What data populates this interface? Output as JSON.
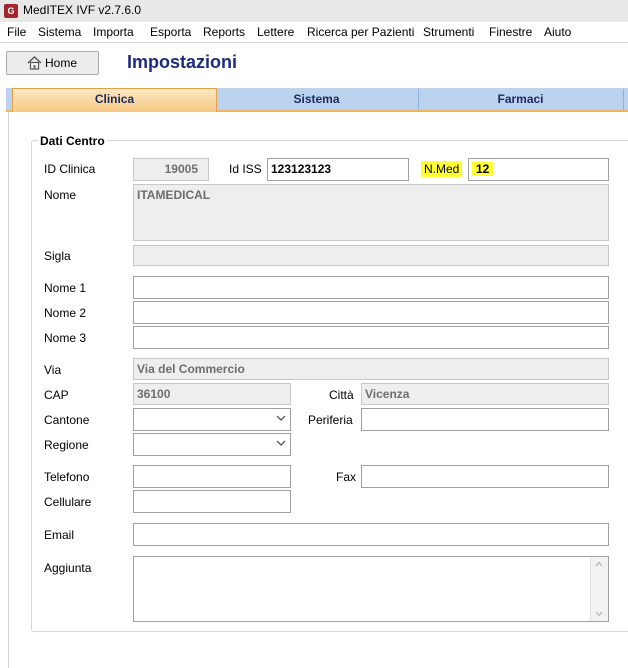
{
  "window": {
    "title": "MedITEX IVF v2.7.6.0",
    "logo_text": "G"
  },
  "menu": [
    "File",
    "Sistema",
    "Importa",
    "Esporta",
    "Reports",
    "Lettere",
    "Ricerca per Pazienti",
    "Strumenti",
    "Finestre",
    "Aiuto"
  ],
  "header": {
    "home_label": "Home",
    "page_title": "Impostazioni"
  },
  "tabs": [
    {
      "label": "Clinica",
      "active": true
    },
    {
      "label": "Sistema",
      "active": false
    },
    {
      "label": "Farmaci",
      "active": false
    }
  ],
  "group": {
    "legend": "Dati Centro",
    "labels": {
      "id_clinica": "ID Clinica",
      "id_iss": "Id ISS",
      "n_med": "N.Med",
      "nome": "Nome",
      "sigla": "Sigla",
      "nome1": "Nome 1",
      "nome2": "Nome 2",
      "nome3": "Nome 3",
      "via": "Via",
      "cap": "CAP",
      "citta": "Città",
      "cantone": "Cantone",
      "periferia": "Periferia",
      "regione": "Regione",
      "telefono": "Telefono",
      "fax": "Fax",
      "cellulare": "Cellulare",
      "email": "Email",
      "aggiunta": "Aggiunta"
    },
    "values": {
      "id_clinica": "19005",
      "id_iss": "123123123",
      "n_med": "12",
      "nome": "ITAMEDICAL",
      "sigla": "",
      "nome1": "",
      "nome2": "",
      "nome3": "",
      "via": "Via del Commercio",
      "cap": "36100",
      "citta": "Vicenza",
      "cantone": "",
      "periferia": "",
      "regione": "",
      "telefono": "",
      "fax": "",
      "cellulare": "",
      "email": "",
      "aggiunta": ""
    }
  },
  "colors": {
    "title_blue": "#1d2b7d",
    "tab_active": "#f7c882",
    "tab_strip": "#bcd3ef",
    "highlight": "#ffff33"
  },
  "icons": [
    "app-logo-icon",
    "home-icon",
    "chevron-down-icon",
    "scroll-up-icon",
    "scroll-down-icon"
  ]
}
